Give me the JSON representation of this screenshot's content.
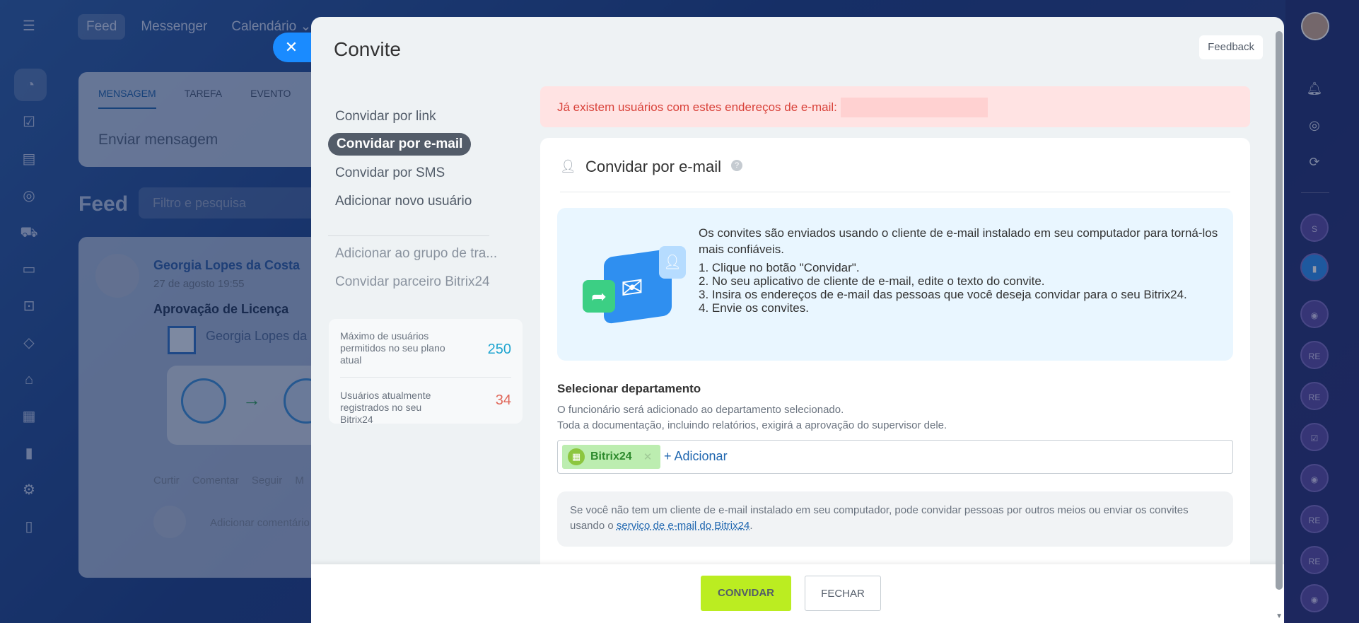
{
  "background_app": {
    "top_tabs": [
      "Feed",
      "Messenger",
      "Calendário ⌄"
    ],
    "composer": {
      "tabs": [
        "MENSAGEM",
        "TAREFA",
        "EVENTO"
      ],
      "placeholder": "Enviar mensagem"
    },
    "feed": {
      "title": "Feed",
      "filter_placeholder": "Filtro e pesquisa",
      "post": {
        "author": "Georgia Lopes da Costa",
        "date": "27 de agosto 19:55",
        "title": "Aprovação de Licença",
        "subtitle": "Georgia Lopes da C",
        "actions": "Curtir Comentar Seguir M",
        "comment_placeholder": "Adicionar comentário"
      }
    },
    "right_rail_badges": [
      "S",
      "RE",
      "RE",
      "RE",
      "RE"
    ]
  },
  "slider": {
    "title": "Convite",
    "feedback": "Feedback",
    "menu": {
      "items": [
        "Convidar por link",
        "Convidar por e-mail",
        "Convidar por SMS",
        "Adicionar novo usuário"
      ],
      "secondary": [
        "Adicionar ao grupo de tra...",
        "Convidar parceiro Bitrix24"
      ]
    },
    "stats": {
      "max_label": "Máximo de usuários permitidos no seu plano atual",
      "max_value": "250",
      "current_label": "Usuários atualmente registrados no seu Bitrix24",
      "current_value": "34"
    },
    "alert": "Já existem usuários com estes endereços de e-mail:",
    "card": {
      "heading": "Convidar por e-mail",
      "info_intro": "Os convites são enviados usando o cliente de e-mail instalado em seu computador para torná-los mais confiáveis.",
      "steps": [
        "1. Clique no botão \"Convidar\".",
        "2. No seu aplicativo de cliente de e-mail, edite o texto do convite.",
        "3. Insira os endereços de e-mail das pessoas que você deseja convidar para o seu Bitrix24.",
        "4. Envie os convites."
      ],
      "department": {
        "title": "Selecionar departamento",
        "desc1": "O funcionário será adicionado ao departamento selecionado.",
        "desc2": "Toda a documentação, incluindo relatórios, exigirá a aprovação do supervisor dele.",
        "chip": "Bitrix24",
        "add": "+ Adicionar"
      },
      "note_text": "Se você não tem um cliente de e-mail instalado em seu computador, pode convidar pessoas por outros meios ou enviar os convites usando o ",
      "note_link": "serviço de e-mail do Bitrix24",
      "note_end": "."
    },
    "buttons": {
      "invite": "CONVIDAR",
      "close": "FECHAR"
    }
  },
  "colors": {
    "accent": "#bbed21",
    "link": "#2067b0",
    "alert_text": "#d9423a",
    "stat_blue": "#1fa5d0",
    "stat_red": "#e0685a"
  }
}
